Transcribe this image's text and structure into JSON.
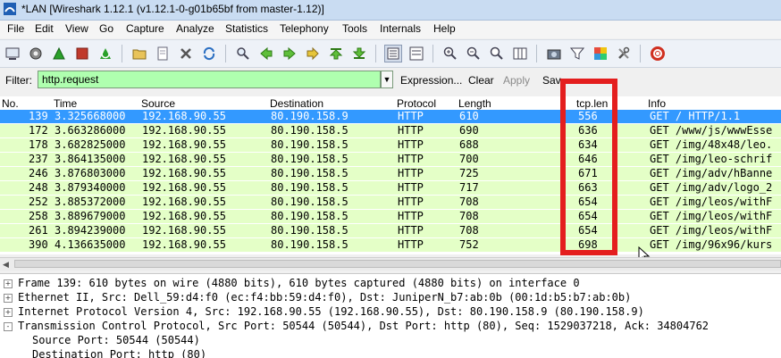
{
  "window": {
    "title": "*LAN   [Wireshark 1.12.1  (v1.12.1-0-g01b65bf from master-1.12)]"
  },
  "menu": [
    "File",
    "Edit",
    "View",
    "Go",
    "Capture",
    "Analyze",
    "Statistics",
    "Telephony",
    "Tools",
    "Internals",
    "Help"
  ],
  "filter": {
    "label": "Filter:",
    "value": "http.request",
    "expression_label": "Expression...",
    "clear_label": "Clear",
    "apply_label": "Apply",
    "save_label": "Sav"
  },
  "packet_list": {
    "columns": [
      "No.",
      "Time",
      "Source",
      "Destination",
      "Protocol",
      "Length",
      "tcp.len",
      "Info"
    ],
    "rows": [
      {
        "no": "139",
        "time": "3.325668000",
        "src": "192.168.90.55",
        "dst": "80.190.158.9",
        "proto": "HTTP",
        "len": "610",
        "tcplen": "556",
        "info": "GET / HTTP/1.1"
      },
      {
        "no": "172",
        "time": "3.663286000",
        "src": "192.168.90.55",
        "dst": "80.190.158.5",
        "proto": "HTTP",
        "len": "690",
        "tcplen": "636",
        "info": "GET /www/js/wwwEsse"
      },
      {
        "no": "178",
        "time": "3.682825000",
        "src": "192.168.90.55",
        "dst": "80.190.158.5",
        "proto": "HTTP",
        "len": "688",
        "tcplen": "634",
        "info": "GET /img/48x48/leo."
      },
      {
        "no": "237",
        "time": "3.864135000",
        "src": "192.168.90.55",
        "dst": "80.190.158.5",
        "proto": "HTTP",
        "len": "700",
        "tcplen": "646",
        "info": "GET /img/leo-schrif"
      },
      {
        "no": "246",
        "time": "3.876803000",
        "src": "192.168.90.55",
        "dst": "80.190.158.5",
        "proto": "HTTP",
        "len": "725",
        "tcplen": "671",
        "info": "GET /img/adv/hBanne"
      },
      {
        "no": "248",
        "time": "3.879340000",
        "src": "192.168.90.55",
        "dst": "80.190.158.5",
        "proto": "HTTP",
        "len": "717",
        "tcplen": "663",
        "info": "GET /img/adv/logo_2"
      },
      {
        "no": "252",
        "time": "3.885372000",
        "src": "192.168.90.55",
        "dst": "80.190.158.5",
        "proto": "HTTP",
        "len": "708",
        "tcplen": "654",
        "info": "GET /img/leos/withF"
      },
      {
        "no": "258",
        "time": "3.889679000",
        "src": "192.168.90.55",
        "dst": "80.190.158.5",
        "proto": "HTTP",
        "len": "708",
        "tcplen": "654",
        "info": "GET /img/leos/withF"
      },
      {
        "no": "261",
        "time": "3.894239000",
        "src": "192.168.90.55",
        "dst": "80.190.158.5",
        "proto": "HTTP",
        "len": "708",
        "tcplen": "654",
        "info": "GET /img/leos/withF"
      },
      {
        "no": "390",
        "time": "4.136635000",
        "src": "192.168.90.55",
        "dst": "80.190.158.5",
        "proto": "HTTP",
        "len": "752",
        "tcplen": "698",
        "info": "GET /img/96x96/kurs"
      }
    ]
  },
  "details": [
    {
      "expander": "+",
      "text": "Frame 139: 610 bytes on wire (4880 bits), 610 bytes captured (4880 bits) on interface 0"
    },
    {
      "expander": "+",
      "text": "Ethernet II, Src: Dell_59:d4:f0 (ec:f4:bb:59:d4:f0), Dst: JuniperN_b7:ab:0b (00:1d:b5:b7:ab:0b)"
    },
    {
      "expander": "+",
      "text": "Internet Protocol Version 4, Src: 192.168.90.55 (192.168.90.55), Dst: 80.190.158.9 (80.190.158.9)"
    },
    {
      "expander": "-",
      "text": "Transmission Control Protocol, Src Port: 50544 (50544), Dst Port: http (80), Seq: 1529037218, Ack: 34804762"
    },
    {
      "expander": "",
      "text": "Source Port: 50544 (50544)"
    },
    {
      "expander": "",
      "text": "Destination Port: http (80)"
    }
  ],
  "colors": {
    "http_row": "#e4ffc7",
    "selected_row": "#3399ff",
    "filter_valid": "#afffaf",
    "annotation": "#e41e1e"
  }
}
